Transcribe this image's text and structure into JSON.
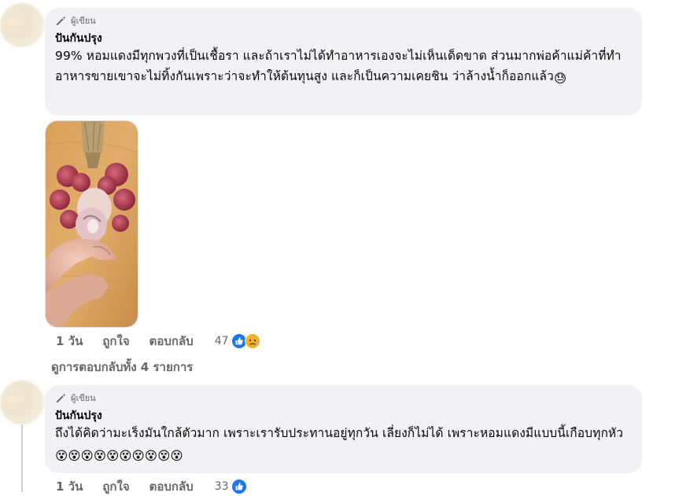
{
  "comment1": {
    "badge_label": "ผู้เขียน",
    "badge_icon": "pencil-icon",
    "author": "ปันกันปรุง",
    "text": "99% หอมแดงมีทุกพวงที่เป็นเชื้อรา และถ้าเราไม่ได้ทำอาหารเองจะไม่เห็นเด็ดขาด ส่วนมากพ่อค้าแม่ค้าที่ทำอาหารขายเขาจะไม่ทิ้งกันเพราะว่าจะทำให้ต้นทุนสูง และก็เป็นความเคยชิน ว่าล้างน้ำก็ออกแล้ว",
    "emoji": "😓",
    "time": "1 วัน",
    "like_label": "ถูกใจ",
    "reply_label": "ตอบกลับ",
    "reaction_count": "47",
    "reaction_icons": [
      "like-icon",
      "sad-icon"
    ]
  },
  "view_replies": "ดูการตอบกลับทั้ง 4 รายการ",
  "comment2": {
    "badge_label": "ผู้เขียน",
    "badge_icon": "pencil-icon",
    "author": "ปันกันปรุง",
    "text": "ถึงได้คิดว่ามะเร็งมันใกล้ตัวมาก เพราะเรารับประทานอยู่ทุกวัน เลี่ยงก็ไม่ได้ เพราะหอมแดงมีแบบนี้เกือบทุกหัว",
    "emoji_repeat": "😵😵😵😵😵😵😵😵😵😵",
    "time": "1 วัน",
    "like_label": "ถูกใจ",
    "reply_label": "ตอบกลับ",
    "reaction_count": "33",
    "reaction_icons": [
      "like-icon"
    ]
  },
  "colors": {
    "bubble": "#f0f2f5",
    "secondary_text": "#65676b",
    "like_blue": "#1877f2",
    "sad_yellow": "#f7b125"
  }
}
